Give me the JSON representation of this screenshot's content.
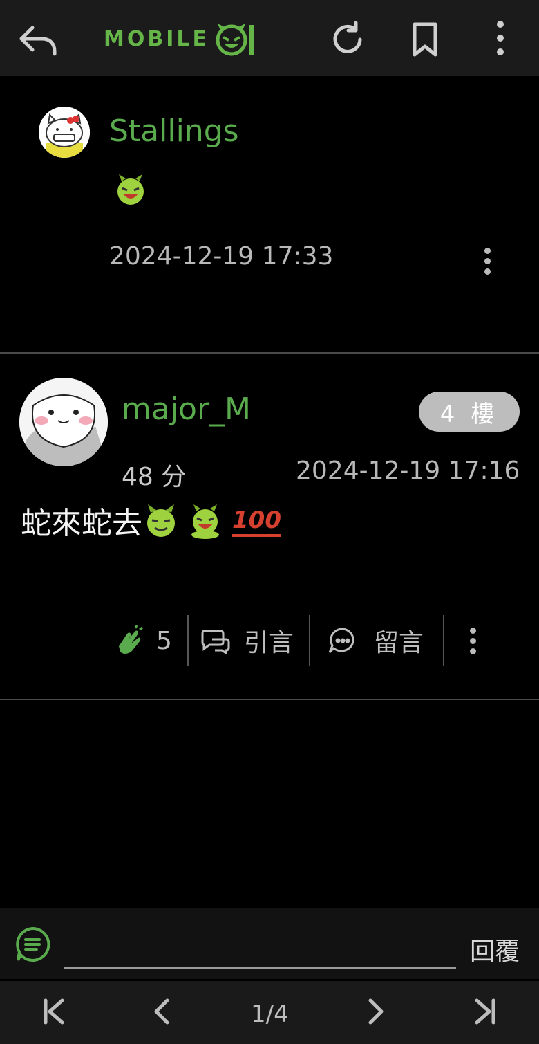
{
  "topbar": {
    "logo_text": "MOBILE",
    "icons": [
      "reply-back-icon",
      "refresh-icon",
      "bookmark-icon",
      "more-vertical-icon"
    ]
  },
  "posts": [
    {
      "username": "Stallings",
      "content_emojis": [
        "laughing-devil-emoji"
      ],
      "timestamp": "2024-12-19 17:33"
    },
    {
      "username": "major_M",
      "floor_badge": "4 樓",
      "score": "48 分",
      "timestamp": "2024-12-19 17:16",
      "content_text": "蛇來蛇去",
      "content_emojis": [
        "smirk-devil-emoji",
        "laughing-devil-emoji",
        "hundred-points-emoji"
      ],
      "hundred_text": "100",
      "actions": {
        "claps": "5",
        "quote_label": "引言",
        "comment_label": "留言"
      }
    }
  ],
  "reply": {
    "label": "回覆",
    "icon": "message-icon"
  },
  "pager": {
    "current": "1/4",
    "icons": [
      "first-page-icon",
      "prev-page-icon",
      "next-page-icon",
      "last-page-icon"
    ]
  },
  "colors": {
    "brand_green": "#66b548",
    "username_green": "#5aab4d",
    "background": "#000000",
    "bar": "#1b1b1b"
  }
}
